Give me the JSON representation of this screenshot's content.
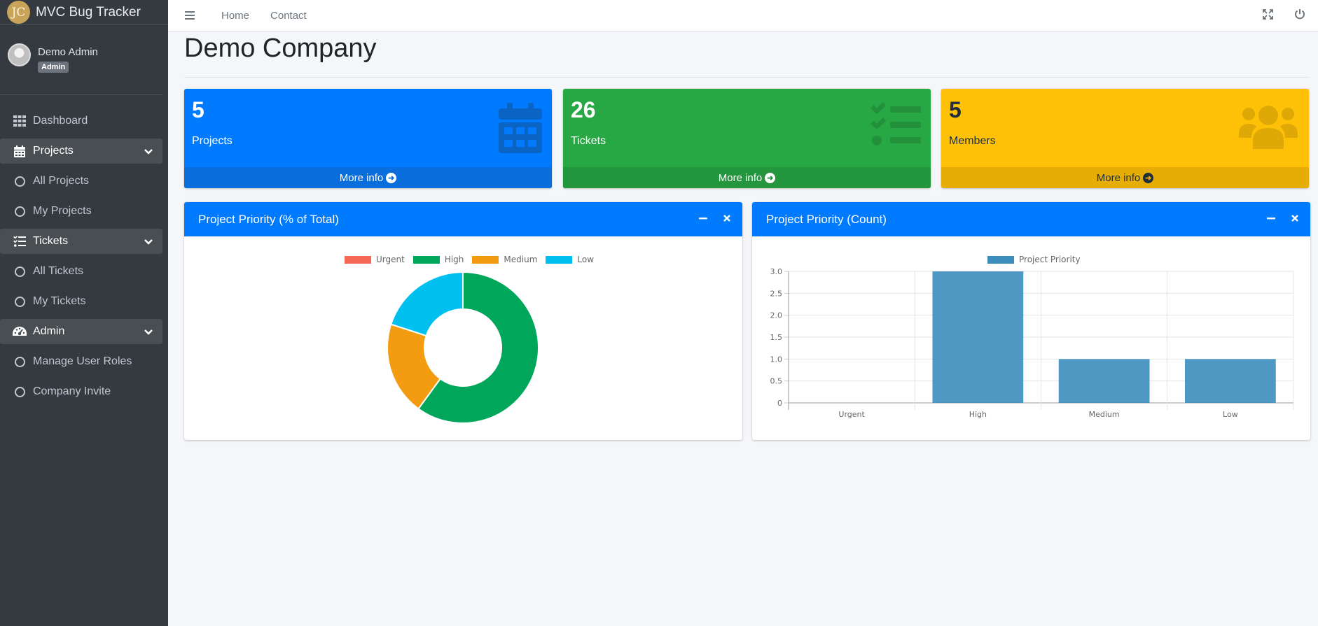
{
  "brand": {
    "logo_text": "JC",
    "title": "MVC Bug Tracker"
  },
  "user": {
    "name": "Demo Admin",
    "role_badge": "Admin"
  },
  "sidebar": {
    "items": [
      {
        "label": "Dashboard",
        "icon": "grid-icon"
      },
      {
        "label": "Projects",
        "icon": "calendar-icon",
        "expanded": true
      },
      {
        "label": "All Projects",
        "icon": "circle-icon"
      },
      {
        "label": "My Projects",
        "icon": "circle-icon"
      },
      {
        "label": "Tickets",
        "icon": "tasks-icon",
        "expanded": true
      },
      {
        "label": "All Tickets",
        "icon": "circle-icon"
      },
      {
        "label": "My Tickets",
        "icon": "circle-icon"
      },
      {
        "label": "Admin",
        "icon": "gauge-icon",
        "expanded": true
      },
      {
        "label": "Manage User Roles",
        "icon": "circle-icon"
      },
      {
        "label": "Company Invite",
        "icon": "circle-icon"
      }
    ]
  },
  "topbar": {
    "links": [
      "Home",
      "Contact"
    ]
  },
  "page": {
    "title": "Demo Company"
  },
  "boxes": [
    {
      "value": "5",
      "label": "Projects",
      "footer": "More info",
      "color": "#007bff",
      "icon": "calendar-icon"
    },
    {
      "value": "26",
      "label": "Tickets",
      "footer": "More info",
      "color": "#28a745",
      "icon": "tasks-icon"
    },
    {
      "value": "5",
      "label": "Members",
      "footer": "More info",
      "color": "#ffc107",
      "icon": "users-icon"
    }
  ],
  "cards": {
    "donut": {
      "title": "Project Priority (% of Total)"
    },
    "bar": {
      "title": "Project Priority (Count)"
    }
  },
  "colors": {
    "urgent": "#f56954",
    "high": "#00a65a",
    "medium": "#f39c12",
    "low": "#00c0ef",
    "bar": "#3c8dbc"
  },
  "chart_data": [
    {
      "type": "pie",
      "title": "Project Priority (% of Total)",
      "categories": [
        "Urgent",
        "High",
        "Medium",
        "Low"
      ],
      "values": [
        0,
        3,
        1,
        1
      ],
      "colors": [
        "#f56954",
        "#00a65a",
        "#f39c12",
        "#00c0ef"
      ],
      "legend": "top"
    },
    {
      "type": "bar",
      "title": "Project Priority (Count)",
      "categories": [
        "Urgent",
        "High",
        "Medium",
        "Low"
      ],
      "series": [
        {
          "name": "Project Priority",
          "values": [
            0,
            3,
            1,
            1
          ]
        }
      ],
      "ylim": [
        0,
        3.0
      ],
      "yticks": [
        "0",
        "0.5",
        "1.0",
        "1.5",
        "2.0",
        "2.5",
        "3.0"
      ],
      "grid": true,
      "legend": "top"
    }
  ]
}
